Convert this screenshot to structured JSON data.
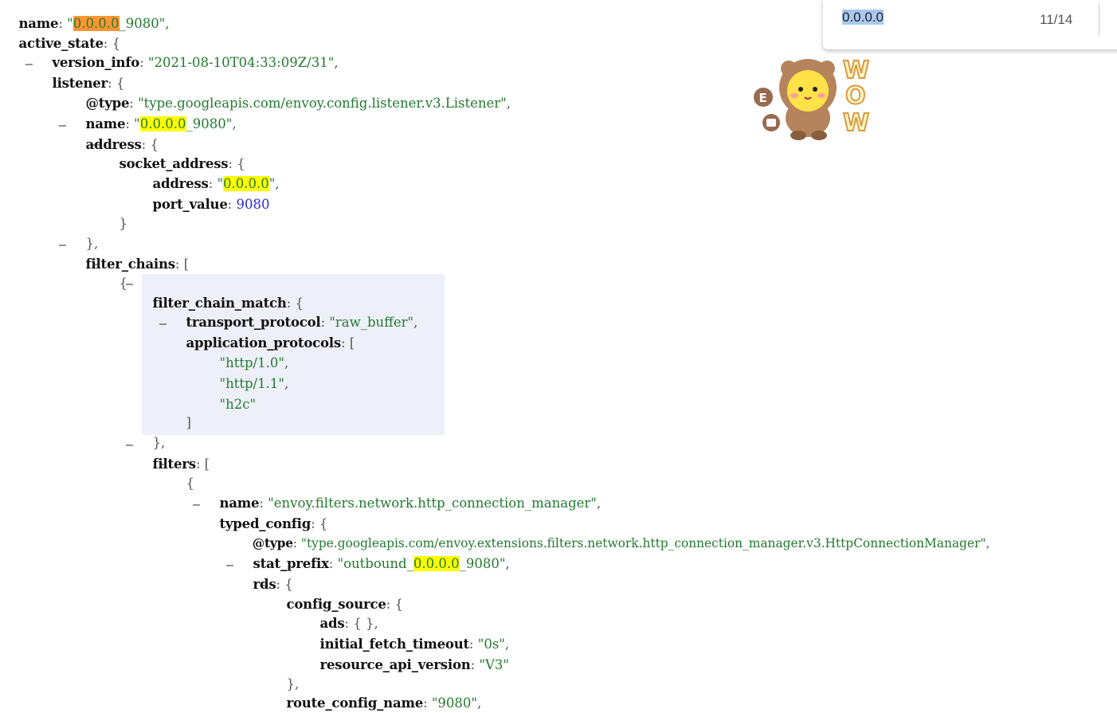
{
  "find_bar": {
    "query": "0.0.0.0",
    "count": "11/14"
  },
  "sticker": {
    "letters": [
      "W",
      "O",
      "W"
    ],
    "badge": "E"
  },
  "lines": {
    "l0": {
      "key": "name",
      "pre": "\"",
      "hl": "0.0.0.0",
      "post": "_9080\","
    },
    "l1": {
      "key": "active_state",
      "rest": ": {"
    },
    "l2": {
      "key": "version_info",
      "val": "\"2021-08-10T04:33:09Z/31\"",
      "tail": ","
    },
    "l3": {
      "key": "listener",
      "rest": ": {"
    },
    "l4": {
      "key": "@type",
      "val": "\"type.googleapis.com/envoy.config.listener.v3.Listener\"",
      "tail": ","
    },
    "l5": {
      "key": "name",
      "pre": "\"",
      "hl": "0.0.0.0",
      "post": "_9080\","
    },
    "l6": {
      "key": "address",
      "rest": ": {"
    },
    "l7": {
      "key": "socket_address",
      "rest": ": {"
    },
    "l8": {
      "key": "address",
      "pre": "\"",
      "hl": "0.0.0.0",
      "post": "\","
    },
    "l9": {
      "key": "port_value",
      "val": "9080"
    },
    "l10": {
      "text": "}"
    },
    "l11": {
      "text": "},"
    },
    "l12": {
      "key": "filter_chains",
      "rest": ": ["
    },
    "l13": {
      "text": "{"
    },
    "l14": {
      "key": "filter_chain_match",
      "rest": ": {"
    },
    "l15": {
      "key": "transport_protocol",
      "val": "\"raw_buffer\"",
      "tail": ","
    },
    "l16": {
      "key": "application_protocols",
      "rest": ": ["
    },
    "l17": {
      "val": "\"http/1.0\"",
      "tail": ","
    },
    "l18": {
      "val": "\"http/1.1\"",
      "tail": ","
    },
    "l19": {
      "val": "\"h2c\""
    },
    "l20": {
      "text": "]"
    },
    "l21": {
      "text": "},"
    },
    "l22": {
      "key": "filters",
      "rest": ": ["
    },
    "l23": {
      "text": "{"
    },
    "l24": {
      "key": "name",
      "val": "\"envoy.filters.network.http_connection_manager\"",
      "tail": ","
    },
    "l25": {
      "key": "typed_config",
      "rest": ": {"
    },
    "l26": {
      "key": "@type",
      "val": "\"type.googleapis.com/envoy.extensions.filters.network.http_connection_manager.v3.HttpConnectionManager\"",
      "tail": ","
    },
    "l27": {
      "key": "stat_prefix",
      "pre": "\"outbound_",
      "hl": "0.0.0.0",
      "post": "_9080\","
    },
    "l28": {
      "key": "rds",
      "rest": ": {"
    },
    "l29": {
      "key": "config_source",
      "rest": ": {"
    },
    "l30": {
      "key": "ads",
      "rest": ": { },"
    },
    "l31": {
      "key": "initial_fetch_timeout",
      "val": "\"0s\"",
      "tail": ","
    },
    "l32": {
      "key": "resource_api_version",
      "val": "\"V3\""
    },
    "l33": {
      "text": "},"
    },
    "l34": {
      "key": "route_config_name",
      "val": "\"9080\"",
      "tail": ","
    }
  },
  "toggle_symbol": "–",
  "colon": ": "
}
